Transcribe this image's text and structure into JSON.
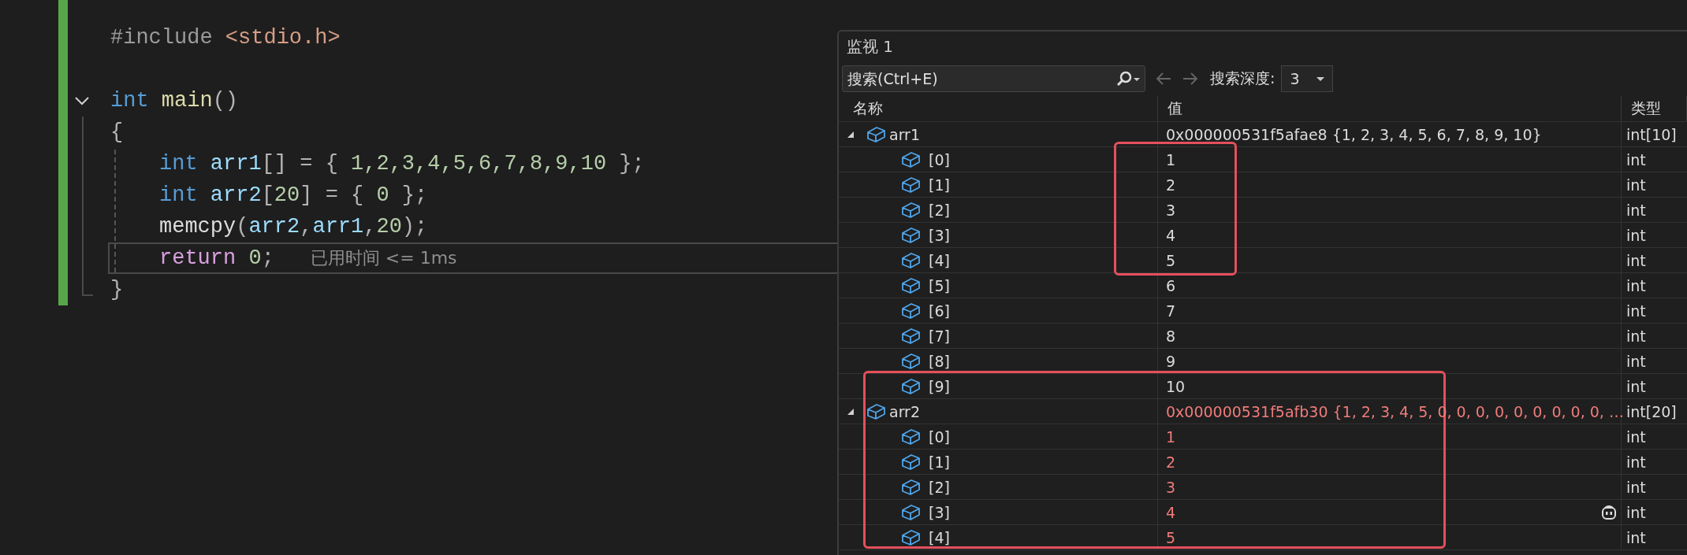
{
  "editor": {
    "lines": [
      {
        "tokens": [
          {
            "text": "#include ",
            "kind": "preproc"
          },
          {
            "text": "<stdio.h>",
            "kind": "string"
          }
        ]
      },
      {
        "gap_before": true,
        "fold": true,
        "tokens": [
          {
            "text": "int ",
            "kind": "keyword"
          },
          {
            "text": "main",
            "kind": "func"
          },
          {
            "text": "()",
            "kind": "punct"
          }
        ],
        "children": [
          {
            "tokens": [
              {
                "text": "{",
                "kind": "punct"
              }
            ]
          },
          {
            "indented": true,
            "tokens": [
              {
                "text": "int ",
                "kind": "keyword"
              },
              {
                "text": "arr1",
                "kind": "var"
              },
              {
                "text": "[] = { ",
                "kind": "punct"
              },
              {
                "text": "1,2,3,4,5,6,7,8,9,10",
                "kind": "number"
              },
              {
                "text": " };",
                "kind": "punct"
              }
            ]
          },
          {
            "indented": true,
            "tokens": [
              {
                "text": "int ",
                "kind": "keyword"
              },
              {
                "text": "arr2",
                "kind": "var"
              },
              {
                "text": "[",
                "kind": "punct"
              },
              {
                "text": "20",
                "kind": "number"
              },
              {
                "text": "] = { ",
                "kind": "punct"
              },
              {
                "text": "0",
                "kind": "number"
              },
              {
                "text": " };",
                "kind": "punct"
              }
            ]
          },
          {
            "indented": true,
            "tokens": [
              {
                "text": "memcpy",
                "kind": "call"
              },
              {
                "text": "(",
                "kind": "punct"
              },
              {
                "text": "arr2",
                "kind": "var"
              },
              {
                "text": ",",
                "kind": "punct"
              },
              {
                "text": "arr1",
                "kind": "var"
              },
              {
                "text": ",",
                "kind": "punct"
              },
              {
                "text": "20",
                "kind": "number"
              },
              {
                "text": ");",
                "kind": "punct"
              }
            ]
          },
          {
            "indented": true,
            "current": true,
            "hint": "已用时间 <= 1ms",
            "tokens": [
              {
                "text": "return ",
                "kind": "control"
              },
              {
                "text": "0",
                "kind": "number"
              },
              {
                "text": ";",
                "kind": "punct"
              }
            ]
          },
          {
            "tokens": [
              {
                "text": "}",
                "kind": "punct"
              }
            ]
          }
        ]
      }
    ]
  },
  "watch": {
    "title": "监视 1",
    "search": {
      "placeholder": "搜索(Ctrl+E)"
    },
    "depth_label": "搜索深度:",
    "depth_value": "3",
    "columns": [
      "名称",
      "值",
      "类型"
    ],
    "rows": [
      {
        "name": "arr1",
        "value": "0x000000531f5afae8 {1, 2, 3, 4, 5, 6, 7, 8, 9, 10}",
        "type": "int[10]",
        "changed": false,
        "expanded": true,
        "children": [
          {
            "name": "[0]",
            "value": "1",
            "type": "int",
            "changed": false
          },
          {
            "name": "[1]",
            "value": "2",
            "type": "int",
            "changed": false
          },
          {
            "name": "[2]",
            "value": "3",
            "type": "int",
            "changed": false
          },
          {
            "name": "[3]",
            "value": "4",
            "type": "int",
            "changed": false
          },
          {
            "name": "[4]",
            "value": "5",
            "type": "int",
            "changed": false
          },
          {
            "name": "[5]",
            "value": "6",
            "type": "int",
            "changed": false
          },
          {
            "name": "[6]",
            "value": "7",
            "type": "int",
            "changed": false
          },
          {
            "name": "[7]",
            "value": "8",
            "type": "int",
            "changed": false
          },
          {
            "name": "[8]",
            "value": "9",
            "type": "int",
            "changed": false
          },
          {
            "name": "[9]",
            "value": "10",
            "type": "int",
            "changed": false
          }
        ]
      },
      {
        "name": "arr2",
        "value": "0x000000531f5afb30 {1, 2, 3, 4, 5, 0, 0, 0, 0, 0, 0, 0, 0, 0, …",
        "type": "int[20]",
        "changed": true,
        "expanded": true,
        "children": [
          {
            "name": "[0]",
            "value": "1",
            "type": "int",
            "changed": true
          },
          {
            "name": "[1]",
            "value": "2",
            "type": "int",
            "changed": true
          },
          {
            "name": "[2]",
            "value": "3",
            "type": "int",
            "changed": true
          },
          {
            "name": "[3]",
            "value": "4",
            "type": "int",
            "changed": true,
            "assistant_icon": true
          },
          {
            "name": "[4]",
            "value": "5",
            "type": "int",
            "changed": true
          }
        ]
      }
    ]
  }
}
